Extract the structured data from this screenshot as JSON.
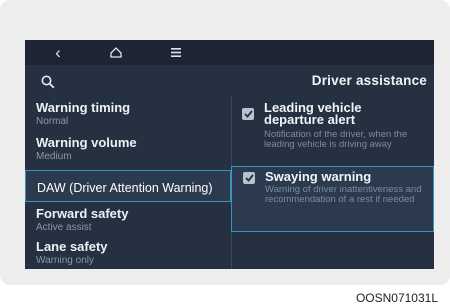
{
  "nav": {
    "back_icon": "back-arrow-icon",
    "home_icon": "home-icon",
    "menu_icon": "menu-icon",
    "search_icon": "search-icon"
  },
  "header": {
    "title": "Driver assistance"
  },
  "menu": {
    "items": [
      {
        "label": "Warning timing",
        "sub": "Normal"
      },
      {
        "label": "Warning volume",
        "sub": "Medium"
      },
      {
        "label": "DAW (Driver Attention Warning)",
        "sub": ""
      },
      {
        "label": "Forward safety",
        "sub": "Active assist"
      },
      {
        "label": "Lane safety",
        "sub": "Warning only"
      }
    ],
    "selected_index": 2
  },
  "options": [
    {
      "label": "Leading vehicle departure alert",
      "desc": "Notification of the driver, when the leading vehicle is driving away",
      "checked": true
    },
    {
      "label": "Swaying warning",
      "desc": "Warning of driver inattentiveness and recommendation of a rest if needed",
      "checked": true
    }
  ],
  "colors": {
    "screen_bg": "#253041",
    "accent_border": "#3d90c2",
    "checkbox": "#b8c3d0"
  },
  "caption": "OOSN071031L"
}
